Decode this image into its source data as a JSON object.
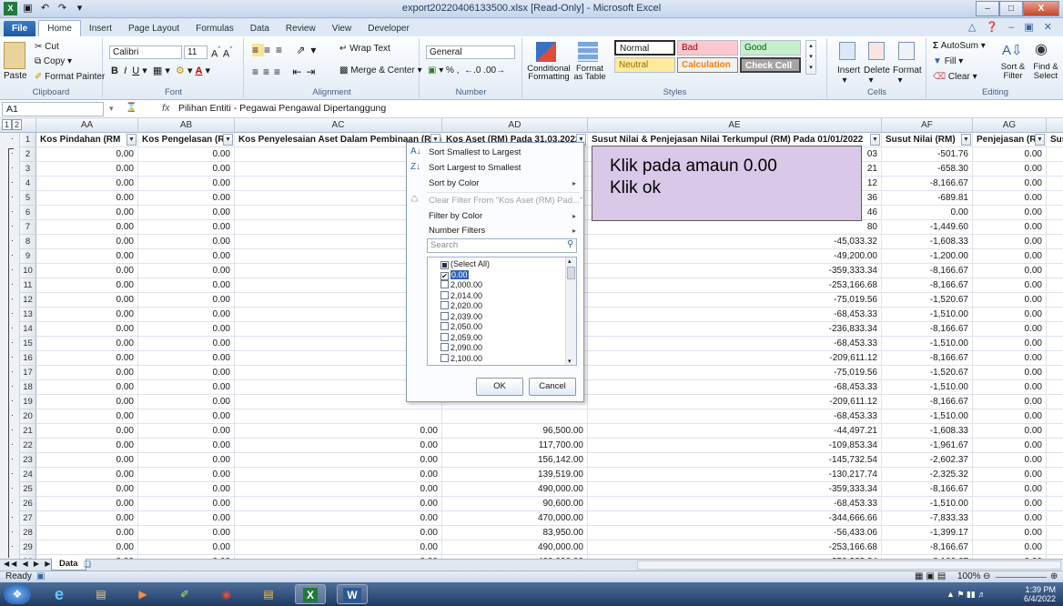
{
  "window": {
    "title": "export20220406133500.xlsx [Read-Only] - Microsoft Excel"
  },
  "tabs": [
    "File",
    "Home",
    "Insert",
    "Page Layout",
    "Formulas",
    "Data",
    "Review",
    "View",
    "Developer"
  ],
  "ribbon": {
    "clipboard": {
      "cut": "Cut",
      "copy": "Copy",
      "paste": "Paste",
      "format_painter": "Format Painter",
      "label": "Clipboard"
    },
    "font": {
      "name": "Calibri",
      "size": "11",
      "label": "Font"
    },
    "alignment": {
      "wrap_text": "Wrap Text",
      "merge_center": "Merge & Center",
      "label": "Alignment"
    },
    "number": {
      "format": "General",
      "percent": "%",
      "comma": ",",
      "label": "Number"
    },
    "styles": {
      "conditional": "Conditional Formatting",
      "format_table": "Format as Table",
      "normal": "Normal",
      "bad": "Bad",
      "good": "Good",
      "neutral": "Neutral",
      "calculation": "Calculation",
      "check_cell": "Check Cell",
      "label": "Styles"
    },
    "cells": {
      "insert": "Insert",
      "delete": "Delete",
      "format": "Format",
      "label": "Cells"
    },
    "editing": {
      "autosum": "AutoSum",
      "fill": "Fill",
      "clear": "Clear",
      "sort_filter": "Sort & Filter",
      "find_select": "Find & Select",
      "label": "Editing"
    }
  },
  "formula_bar": {
    "name_box": "A1",
    "fx": "fx",
    "formula": "Pilihan Entiti - Pegawai Pengawal Dipertanggung"
  },
  "grid": {
    "outline_levels": [
      "1",
      "2"
    ],
    "columns": [
      "AA",
      "AB",
      "AC",
      "AD",
      "AE",
      "AF",
      "AG"
    ],
    "headers": [
      "Kos Pindahan (RM",
      "Kos Pengelasan (RM",
      "Kos Penyelesaian Aset Dalam Pembinaan (RM)",
      "Kos Aset (RM) Pada 31.03.2022",
      "Susut Nilai & Penjejasan Nilai Terkumpul (RM) Pada 01/01/2022",
      "Susut Nilai (RM)",
      "Penjejasan (RM",
      "Susu"
    ],
    "rows": [
      {
        "n": "2",
        "aa": "0.00",
        "ab": "0.00",
        "ae": "03",
        "af": "-501.76",
        "ag": "0.00"
      },
      {
        "n": "3",
        "aa": "0.00",
        "ab": "0.00",
        "ae": "21",
        "af": "-658.30",
        "ag": "0.00"
      },
      {
        "n": "4",
        "aa": "0.00",
        "ab": "0.00",
        "ae": "12",
        "af": "-8,166.67",
        "ag": "0.00"
      },
      {
        "n": "5",
        "aa": "0.00",
        "ab": "0.00",
        "ae": "36",
        "af": "-689.81",
        "ag": "0.00"
      },
      {
        "n": "6",
        "aa": "0.00",
        "ab": "0.00",
        "ae": "46",
        "af": "0.00",
        "ag": "0.00"
      },
      {
        "n": "7",
        "aa": "0.00",
        "ab": "0.00",
        "ae": "80",
        "af": "-1,449.60",
        "ag": "0.00"
      },
      {
        "n": "8",
        "aa": "0.00",
        "ab": "0.00",
        "ae": "-45,033.32",
        "af": "-1,608.33",
        "ag": "0.00"
      },
      {
        "n": "9",
        "aa": "0.00",
        "ab": "0.00",
        "ae": "-49,200.00",
        "af": "-1,200.00",
        "ag": "0.00"
      },
      {
        "n": "10",
        "aa": "0.00",
        "ab": "0.00",
        "ae": "-359,333.34",
        "af": "-8,166.67",
        "ag": "0.00"
      },
      {
        "n": "11",
        "aa": "0.00",
        "ab": "0.00",
        "ae": "-253,166.68",
        "af": "-8,166.67",
        "ag": "0.00"
      },
      {
        "n": "12",
        "aa": "0.00",
        "ab": "0.00",
        "ae": "-75,019.56",
        "af": "-1,520.67",
        "ag": "0.00"
      },
      {
        "n": "13",
        "aa": "0.00",
        "ab": "0.00",
        "ae": "-68,453.33",
        "af": "-1,510.00",
        "ag": "0.00"
      },
      {
        "n": "14",
        "aa": "0.00",
        "ab": "0.00",
        "ae": "-236,833.34",
        "af": "-8,166.67",
        "ag": "0.00"
      },
      {
        "n": "15",
        "aa": "0.00",
        "ab": "0.00",
        "ae": "-68,453.33",
        "af": "-1,510.00",
        "ag": "0.00"
      },
      {
        "n": "16",
        "aa": "0.00",
        "ab": "0.00",
        "ae": "-209,611.12",
        "af": "-8,166.67",
        "ag": "0.00"
      },
      {
        "n": "17",
        "aa": "0.00",
        "ab": "0.00",
        "ae": "-75,019.56",
        "af": "-1,520.67",
        "ag": "0.00"
      },
      {
        "n": "18",
        "aa": "0.00",
        "ab": "0.00",
        "ae": "-68,453.33",
        "af": "-1,510.00",
        "ag": "0.00"
      },
      {
        "n": "19",
        "aa": "0.00",
        "ab": "0.00",
        "ae": "-209,611.12",
        "af": "-8,166.67",
        "ag": "0.00"
      },
      {
        "n": "20",
        "aa": "0.00",
        "ab": "0.00",
        "ae": "-68,453.33",
        "af": "-1,510.00",
        "ag": "0.00"
      },
      {
        "n": "21",
        "aa": "0.00",
        "ab": "0.00",
        "ac": "0.00",
        "ad": "96,500.00",
        "ae": "-44,497.21",
        "af": "-1,608.33",
        "ag": "0.00"
      },
      {
        "n": "22",
        "aa": "0.00",
        "ab": "0.00",
        "ac": "0.00",
        "ad": "117,700.00",
        "ae": "-109,853.34",
        "af": "-1,961.67",
        "ag": "0.00"
      },
      {
        "n": "23",
        "aa": "0.00",
        "ab": "0.00",
        "ac": "0.00",
        "ad": "156,142.00",
        "ae": "-145,732.54",
        "af": "-2,602.37",
        "ag": "0.00"
      },
      {
        "n": "24",
        "aa": "0.00",
        "ab": "0.00",
        "ac": "0.00",
        "ad": "139,519.00",
        "ae": "-130,217.74",
        "af": "-2,325.32",
        "ag": "0.00"
      },
      {
        "n": "25",
        "aa": "0.00",
        "ab": "0.00",
        "ac": "0.00",
        "ad": "490,000.00",
        "ae": "-359,333.34",
        "af": "-8,166.67",
        "ag": "0.00"
      },
      {
        "n": "26",
        "aa": "0.00",
        "ab": "0.00",
        "ac": "0.00",
        "ad": "90,600.00",
        "ae": "-68,453.33",
        "af": "-1,510.00",
        "ag": "0.00"
      },
      {
        "n": "27",
        "aa": "0.00",
        "ab": "0.00",
        "ac": "0.00",
        "ad": "470,000.00",
        "ae": "-344,666.66",
        "af": "-7,833.33",
        "ag": "0.00"
      },
      {
        "n": "28",
        "aa": "0.00",
        "ab": "0.00",
        "ac": "0.00",
        "ad": "83,950.00",
        "ae": "-56,433.06",
        "af": "-1,399.17",
        "ag": "0.00"
      },
      {
        "n": "29",
        "aa": "0.00",
        "ab": "0.00",
        "ac": "0.00",
        "ad": "490,000.00",
        "ae": "-253,166.68",
        "af": "-8,166.67",
        "ag": "0.00"
      },
      {
        "n": "30",
        "aa": "0.00",
        "ab": "0.00",
        "ac": "0.00",
        "ad": "490,000.00",
        "ae": "-359,333.34",
        "af": "-8,166.67",
        "ag": "0.00"
      },
      {
        "n": "31",
        "aa": "0.00",
        "ab": "0.00",
        "ac": "0.00",
        "ad": "90,600.00",
        "ae": "-68,453.33",
        "af": "-1,510.00",
        "ag": "0.00"
      },
      {
        "n": "32",
        "aa": "0.00",
        "ab": "0.00",
        "ac": "0.00",
        "ad": "96,500.00",
        "ae": "-44,497.21",
        "af": "-1,608.33",
        "ag": "0.00"
      }
    ]
  },
  "filter_menu": {
    "sort_asc": "Sort Smallest to Largest",
    "sort_desc": "Sort Largest to Smallest",
    "sort_color": "Sort by Color",
    "clear_filter": "Clear Filter From \"Kos Aset (RM) Pad...\"",
    "filter_color": "Filter by Color",
    "number_filters": "Number Filters",
    "search_placeholder": "Search",
    "items": [
      "(Select All)",
      "0.00",
      "2,000.00",
      "2,014.00",
      "2,020.00",
      "2,039.00",
      "2,050.00",
      "2,059.00",
      "2,090.00",
      "2,100.00"
    ],
    "ok": "OK",
    "cancel": "Cancel"
  },
  "callout": {
    "line1": "Klik pada amaun 0.00",
    "line2": "Klik ok"
  },
  "sheet": {
    "tab": "Data"
  },
  "status": {
    "ready": "Ready",
    "zoom": "100%"
  },
  "taskbar": {
    "time": "1:39 PM",
    "date": "6/4/2022"
  }
}
